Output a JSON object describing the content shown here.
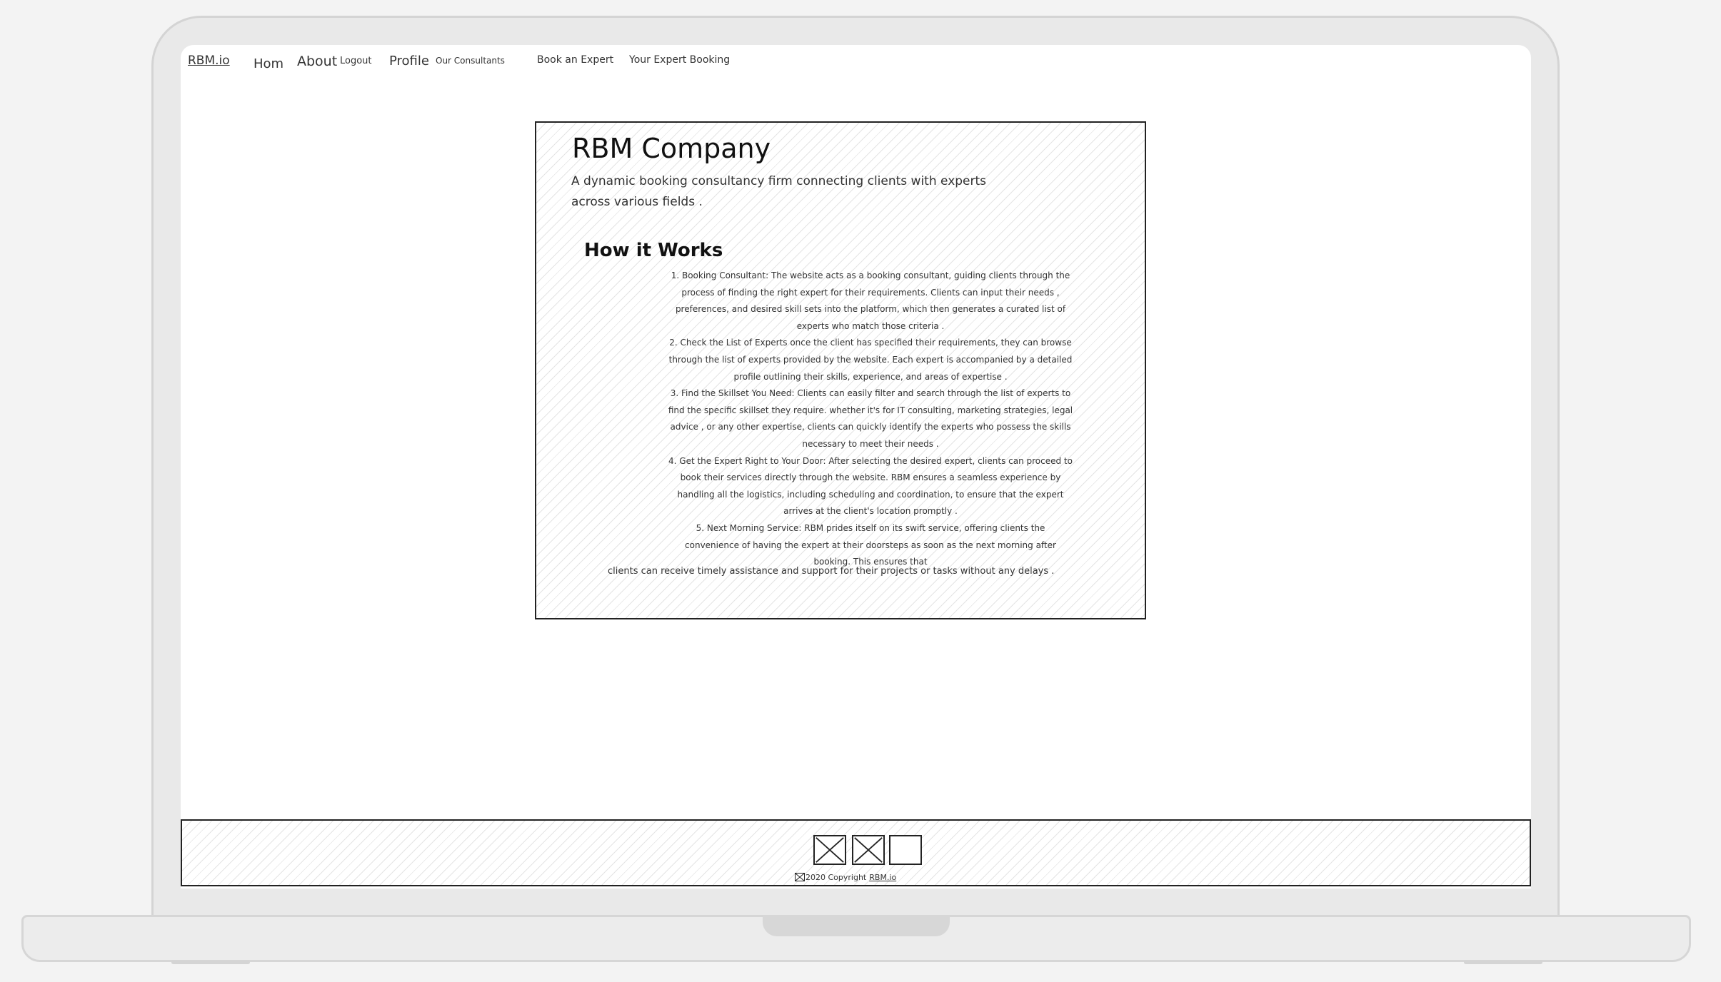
{
  "nav": {
    "brand": "RBM.io",
    "home": "Hom",
    "about": "About",
    "logout": "Logout",
    "profile": "Profile",
    "consultants": "Our Consultants",
    "book": "Book an Expert",
    "your_booking": "Your Expert Booking"
  },
  "hero": {
    "title": "RBM Company",
    "tagline": "A dynamic booking consultancy firm connecting clients with experts across various fields .",
    "how_title": "How it Works",
    "steps": [
      "1. Booking Consultant: The website acts as a booking consultant, guiding clients through the process of finding the right expert for their requirements. Clients can input their needs , preferences, and desired skill sets into the platform, which then generates a curated list of experts who match those criteria .",
      "2. Check the List of Experts once the client has specified their requirements, they can browse through the list of experts provided by the website. Each expert is accompanied by a detailed profile outlining their skills, experience, and areas of expertise .",
      "3. Find the Skillset You Need: Clients can easily filter and search through the list of experts to find the specific skillset they require. whether it's for IT consulting, marketing strategies, legal advice , or any other expertise, clients can quickly identify the experts who possess the skills necessary to meet their needs .",
      "4. Get the Expert Right to Your Door: After selecting the desired expert, clients can proceed to book their services directly through the website. RBM ensures a seamless experience by handling all the logistics, including scheduling and coordination, to ensure that the expert arrives at the client's location promptly .",
      "5. Next Morning Service: RBM prides itself on its swift service, offering clients the convenience of having the expert at their doorsteps as soon as the next morning after booking. This ensures that"
    ],
    "closing": "clients can receive timely assistance and support for their projects or tasks without any delays ."
  },
  "footer": {
    "icons": [
      "image-placeholder-icon",
      "image-placeholder-icon",
      "blank-box-icon"
    ],
    "copyright": "2020 Copyright",
    "brand": "RBM.io"
  }
}
